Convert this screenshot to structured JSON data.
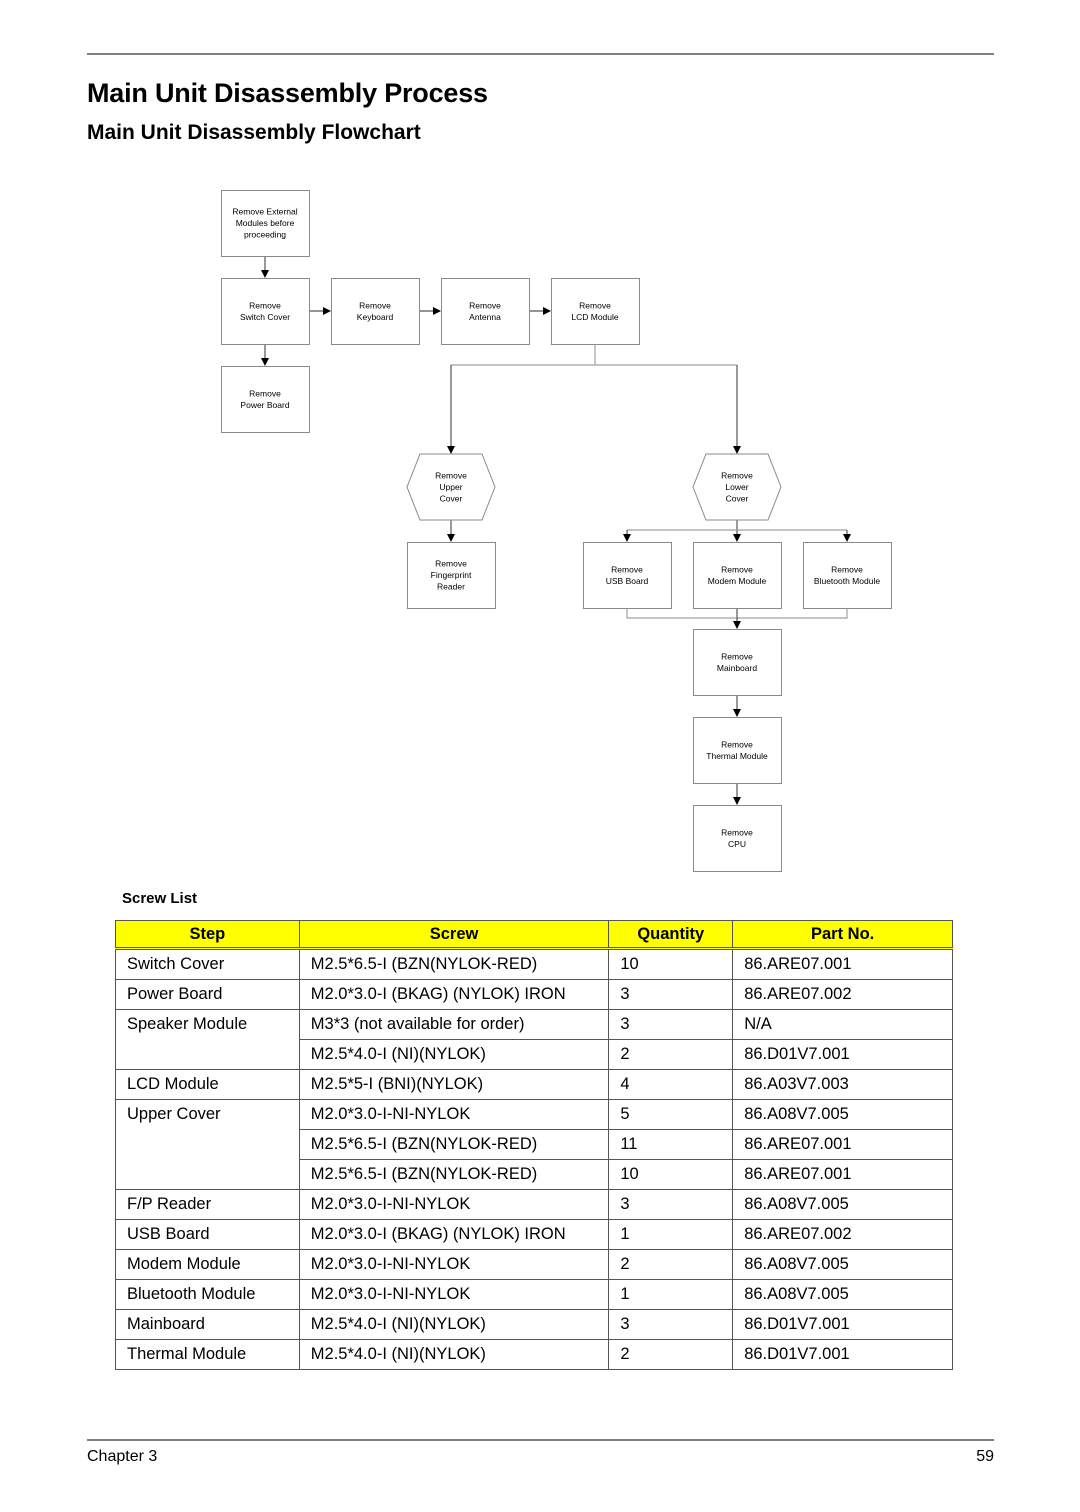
{
  "page": {
    "title": "Main Unit Disassembly Process",
    "subtitle": "Main Unit Disassembly Flowchart",
    "footer": {
      "chapter": "Chapter 3",
      "page_number": "59"
    }
  },
  "flowchart": {
    "nodes": {
      "external": [
        "Remove External",
        "Modules before",
        "proceeding"
      ],
      "switch_cover": [
        "Remove",
        "Switch Cover"
      ],
      "keyboard": [
        "Remove",
        "Keyboard"
      ],
      "antenna": [
        "Remove",
        "Antenna"
      ],
      "lcd_module": [
        "Remove",
        "LCD Module"
      ],
      "power_board": [
        "Remove",
        "Power Board"
      ],
      "upper_cover": [
        "Remove",
        "Upper",
        "Cover"
      ],
      "lower_cover": [
        "Remove",
        "Lower",
        "Cover"
      ],
      "fingerprint": [
        "Remove",
        "Fingerprint",
        "Reader"
      ],
      "usb_board": [
        "Remove",
        "USB Board"
      ],
      "modem_module": [
        "Remove",
        "Modem Module"
      ],
      "bluetooth_module": [
        "Remove",
        "Bluetooth Module"
      ],
      "mainboard": [
        "Remove",
        "Mainboard"
      ],
      "thermal_module": [
        "Remove",
        "Thermal Module"
      ],
      "cpu": [
        "Remove",
        "CPU"
      ]
    }
  },
  "screw_list": {
    "title": "Screw List",
    "header_color": "#ffff00",
    "columns": [
      "Step",
      "Screw",
      "Quantity",
      "Part No."
    ],
    "rows": [
      {
        "step": "Switch Cover",
        "screw": "M2.5*6.5-I (BZN(NYLOK-RED)",
        "quantity": "10",
        "part_no": "86.ARE07.001"
      },
      {
        "step": "Power Board",
        "screw": "M2.0*3.0-I (BKAG) (NYLOK) IRON",
        "quantity": "3",
        "part_no": "86.ARE07.002"
      },
      {
        "step": "Speaker Module",
        "screw": "M3*3 (not available for order)",
        "quantity": "3",
        "part_no": "N/A"
      },
      {
        "step": "",
        "screw": "M2.5*4.0-I (NI)(NYLOK)",
        "quantity": "2",
        "part_no": "86.D01V7.001"
      },
      {
        "step": "LCD Module",
        "screw": "M2.5*5-I (BNI)(NYLOK)",
        "quantity": "4",
        "part_no": "86.A03V7.003"
      },
      {
        "step": "Upper Cover",
        "screw": "M2.0*3.0-I-NI-NYLOK",
        "quantity": "5",
        "part_no": "86.A08V7.005"
      },
      {
        "step": "",
        "screw": "M2.5*6.5-I (BZN(NYLOK-RED)",
        "quantity": "11",
        "part_no": "86.ARE07.001"
      },
      {
        "step": "",
        "screw": "M2.5*6.5-I (BZN(NYLOK-RED)",
        "quantity": "10",
        "part_no": "86.ARE07.001"
      },
      {
        "step": "F/P Reader",
        "screw": "M2.0*3.0-I-NI-NYLOK",
        "quantity": "3",
        "part_no": "86.A08V7.005"
      },
      {
        "step": "USB Board",
        "screw": "M2.0*3.0-I (BKAG) (NYLOK) IRON",
        "quantity": "1",
        "part_no": "86.ARE07.002"
      },
      {
        "step": "Modem Module",
        "screw": "M2.0*3.0-I-NI-NYLOK",
        "quantity": "2",
        "part_no": "86.A08V7.005"
      },
      {
        "step": "Bluetooth Module",
        "screw": "M2.0*3.0-I-NI-NYLOK",
        "quantity": "1",
        "part_no": "86.A08V7.005"
      },
      {
        "step": "Mainboard",
        "screw": "M2.5*4.0-I (NI)(NYLOK)",
        "quantity": "3",
        "part_no": "86.D01V7.001"
      },
      {
        "step": "Thermal Module",
        "screw": "M2.5*4.0-I (NI)(NYLOK)",
        "quantity": "2",
        "part_no": "86.D01V7.001"
      }
    ]
  }
}
